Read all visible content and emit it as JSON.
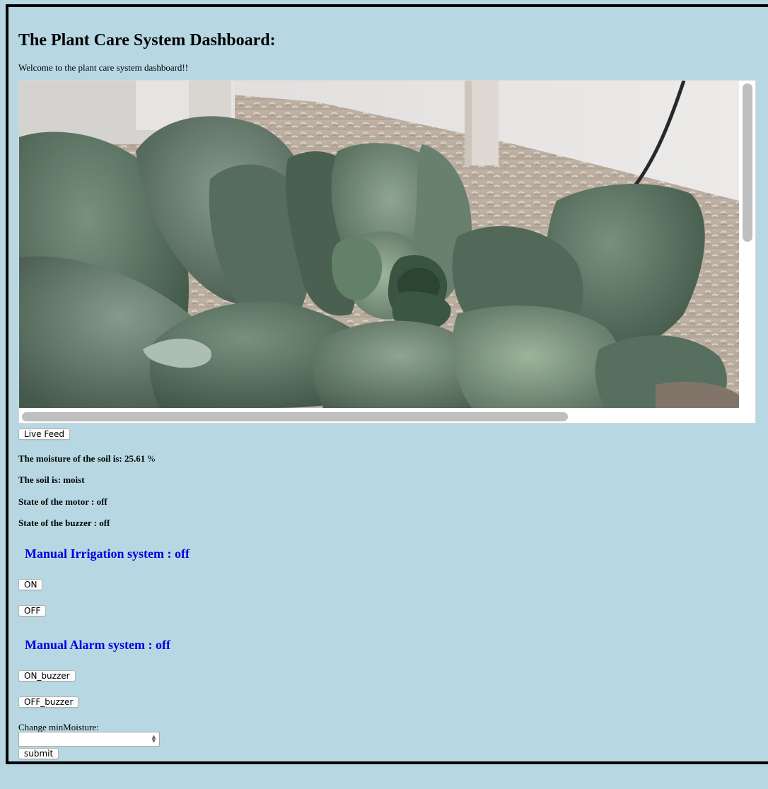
{
  "page": {
    "title": "The Plant Care System Dashboard:",
    "welcome": "Welcome to the plant care system dashboard!!"
  },
  "camera": {
    "button_label": "Live Feed"
  },
  "status": {
    "moisture_label": "The moisture of the soil is:",
    "moisture_value": "25.61",
    "moisture_unit": "%",
    "soil_label": "The soil is:",
    "soil_value": "moist",
    "motor_label": "State of the motor :",
    "motor_value": "off",
    "buzzer_label": "State of the buzzer :",
    "buzzer_value": "off"
  },
  "irrigation": {
    "heading": "Manual Irrigation system : off",
    "on_label": "ON",
    "off_label": "OFF"
  },
  "alarm": {
    "heading": "Manual Alarm system : off",
    "on_label": "ON_buzzer",
    "off_label": "OFF_buzzer"
  },
  "settings": {
    "min_moisture_label": "Change minMoisture:",
    "min_moisture_value": "",
    "submit_label": "submit"
  },
  "colors": {
    "page_background": "#b7d8e3",
    "section_heading": "#0000e0"
  }
}
